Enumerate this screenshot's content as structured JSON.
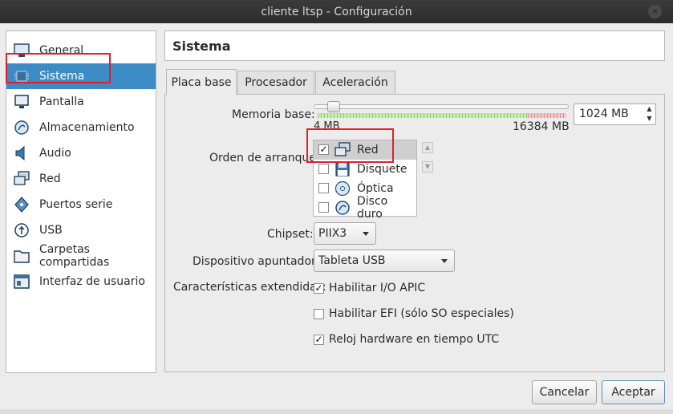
{
  "window": {
    "title": "cliente ltsp - Configuración"
  },
  "sidebar": {
    "items": [
      {
        "label": "General",
        "icon": "general-icon"
      },
      {
        "label": "Sistema",
        "icon": "chip-icon",
        "selected": true
      },
      {
        "label": "Pantalla",
        "icon": "monitor-icon"
      },
      {
        "label": "Almacenamiento",
        "icon": "storage-icon"
      },
      {
        "label": "Audio",
        "icon": "audio-icon"
      },
      {
        "label": "Red",
        "icon": "network-icon"
      },
      {
        "label": "Puertos serie",
        "icon": "serial-icon"
      },
      {
        "label": "USB",
        "icon": "usb-icon"
      },
      {
        "label": "Carpetas compartidas",
        "icon": "folder-icon"
      },
      {
        "label": "Interfaz de usuario",
        "icon": "ui-icon"
      }
    ]
  },
  "header": {
    "title": "Sistema"
  },
  "tabs": [
    {
      "label": "Placa base",
      "active": true
    },
    {
      "label": "Procesador"
    },
    {
      "label": "Aceleración"
    }
  ],
  "motherboard": {
    "memory_label": "Memoria base:",
    "memory_min": "4 MB",
    "memory_max": "16384 MB",
    "memory_value": "1024 MB",
    "memory_fraction": 0.0625,
    "boot_order_label": "Orden de arranque:",
    "boot_devices": [
      {
        "label": "Red",
        "checked": true,
        "icon": "network-icon"
      },
      {
        "label": "Disquete",
        "checked": false,
        "icon": "floppy-icon"
      },
      {
        "label": "Óptica",
        "checked": false,
        "icon": "optical-icon"
      },
      {
        "label": "Disco duro",
        "checked": false,
        "icon": "hard-disk-icon"
      }
    ],
    "chipset_label": "Chipset:",
    "chipset_value": "PIIX3",
    "pointing_label": "Dispositivo apuntador:",
    "pointing_value": "Tableta USB",
    "extended_label": "Características extendidas:",
    "extended_features": [
      {
        "label": "Habilitar I/O APIC",
        "checked": true
      },
      {
        "label": "Habilitar EFI (sólo SO especiales)",
        "checked": false
      },
      {
        "label": "Reloj hardware en tiempo UTC",
        "checked": true
      }
    ]
  },
  "buttons": {
    "cancel": "Cancelar",
    "accept": "Aceptar"
  },
  "colors": {
    "selection": "#3d8bc4",
    "highlight_box": "#e0202a"
  }
}
